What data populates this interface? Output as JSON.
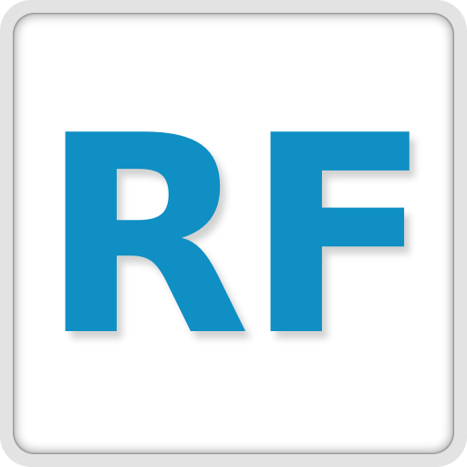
{
  "icon": {
    "monogram": "RF",
    "colors": {
      "letters": "#0f8fc4",
      "tile": "#ffffff",
      "frame": "#e3e3e3"
    }
  }
}
